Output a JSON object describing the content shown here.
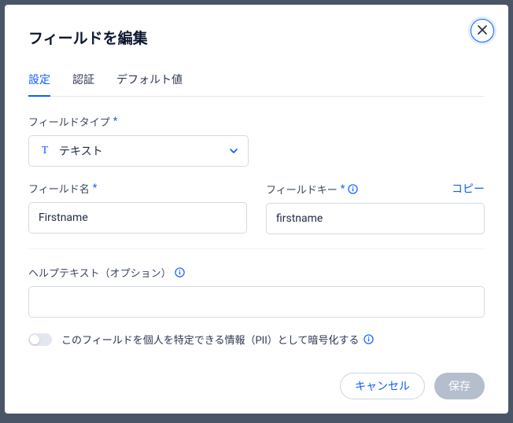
{
  "modal": {
    "title": "フィールドを編集",
    "tabs": [
      {
        "label": "設定"
      },
      {
        "label": "認証"
      },
      {
        "label": "デフォルト値"
      }
    ],
    "fieldType": {
      "label": "フィールドタイプ",
      "value": "テキスト"
    },
    "fieldName": {
      "label": "フィールド名",
      "value": "Firstname"
    },
    "fieldKey": {
      "label": "フィールドキー",
      "value": "firstname",
      "copy": "コピー"
    },
    "helpText": {
      "label": "ヘルプテキスト（オプション）",
      "value": ""
    },
    "piiToggle": {
      "label": "このフィールドを個人を特定できる情報（PII）として暗号化する"
    },
    "buttons": {
      "cancel": "キャンセル",
      "save": "保存"
    }
  }
}
